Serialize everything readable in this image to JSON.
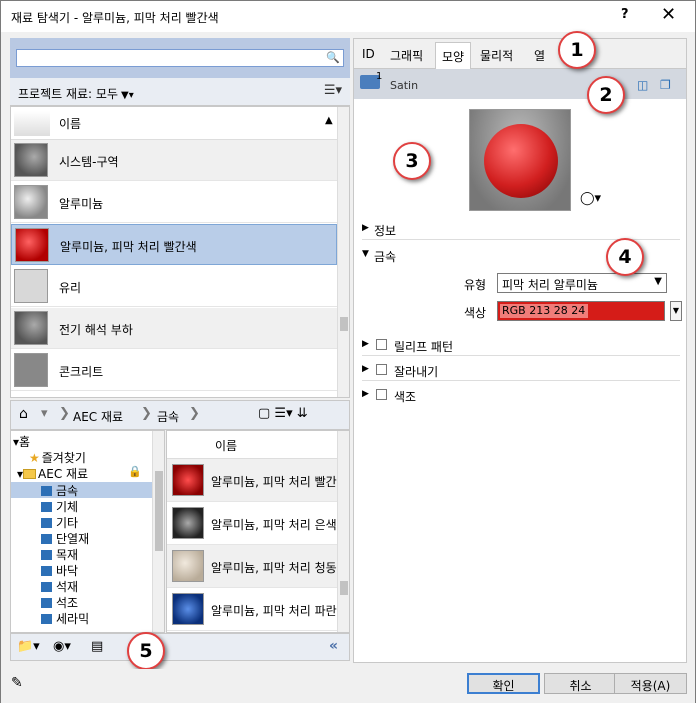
{
  "window": {
    "title": "재료 탐색기 - 알루미늄, 피막 처리 빨간색",
    "help_label": "?",
    "close_label": "✕"
  },
  "search": {
    "value": "",
    "placeholder": ""
  },
  "filter": {
    "label": "프로젝트 재료: 모두"
  },
  "material_list": {
    "header": "이름",
    "items": [
      {
        "label": "시스템-구역"
      },
      {
        "label": "알루미늄"
      },
      {
        "label": "알루미늄, 피막 처리 빨간색"
      },
      {
        "label": "유리"
      },
      {
        "label": "전기 해석 부하"
      },
      {
        "label": "콘크리트"
      }
    ]
  },
  "library_bar": {
    "crumbs": [
      "AEC 재료",
      "금속"
    ]
  },
  "tree": {
    "items": [
      {
        "label": "홈"
      },
      {
        "label": "즐겨찾기"
      },
      {
        "label": "AEC 재료"
      },
      {
        "label": "금속"
      },
      {
        "label": "기체"
      },
      {
        "label": "기타"
      },
      {
        "label": "단열재"
      },
      {
        "label": "목재"
      },
      {
        "label": "바닥"
      },
      {
        "label": "석재"
      },
      {
        "label": "석조"
      },
      {
        "label": "세라믹"
      }
    ]
  },
  "library_list": {
    "header": "이름",
    "items": [
      {
        "label": "알루미늄, 피막 처리 빨간색"
      },
      {
        "label": "알루미늄, 피막 처리 은색"
      },
      {
        "label": "알루미늄, 피막 처리 청동색"
      },
      {
        "label": "알루미늄, 피막 처리 파란색"
      }
    ]
  },
  "tabs": [
    "ID",
    "그래픽",
    "모양",
    "물리적",
    "열"
  ],
  "asset": {
    "number": "1",
    "name": "Satin"
  },
  "sections": {
    "info": "정보",
    "metal": "금속",
    "relief": "릴리프 패턴",
    "cutout": "잘라내기",
    "tint": "색조"
  },
  "properties": {
    "type_label": "유형",
    "type_value": "피막 처리 알루미늄",
    "color_label": "색상",
    "color_value": "RGB 213 28 24"
  },
  "callouts": [
    "1",
    "2",
    "3",
    "4",
    "5"
  ],
  "footer": {
    "ok": "확인",
    "cancel": "취소",
    "apply": "적용(A)"
  },
  "colors": {
    "selection": "#b9cde8",
    "accent_red": "#d51c18",
    "callout_border": "#e04040"
  }
}
